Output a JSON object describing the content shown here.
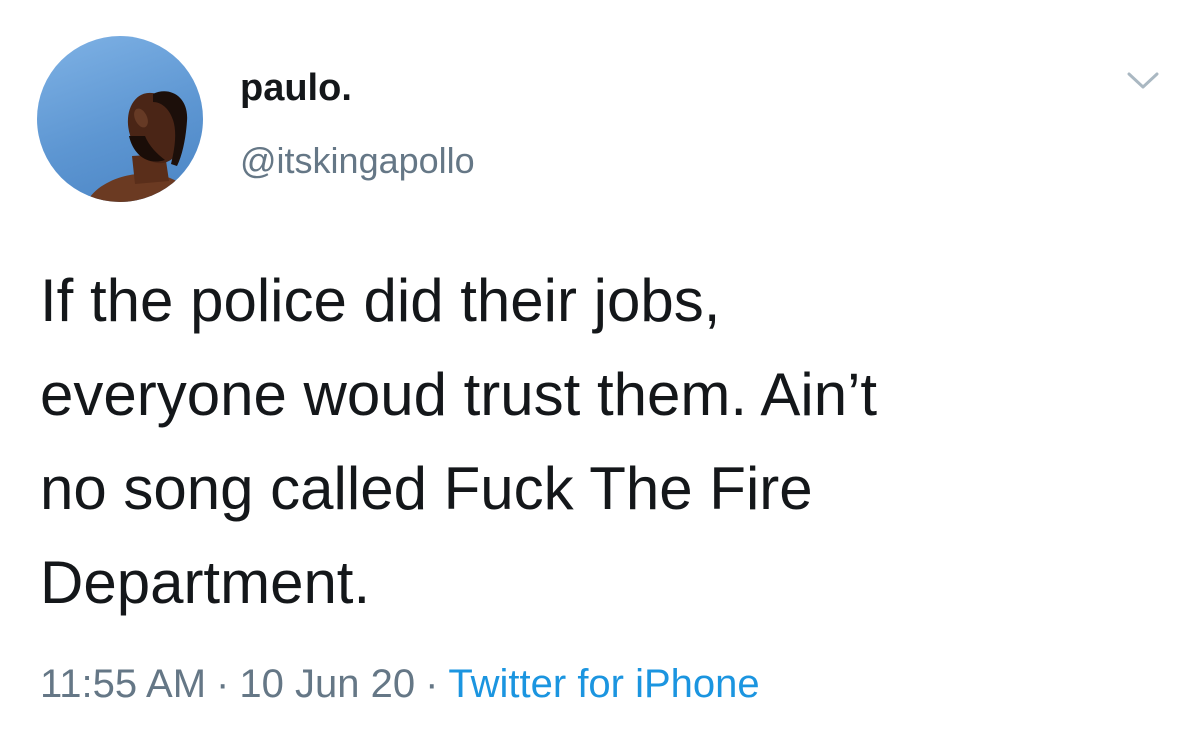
{
  "tweet": {
    "author": {
      "display_name": "paulo.",
      "handle": "@itskingapollo",
      "avatar_icon": "profile-photo"
    },
    "menu_icon": "chevron-down-icon",
    "text": "If the police did their jobs,\neveryone woud trust them. Ain’t\nno song called Fuck The Fire\nDepartment.",
    "time": "11:55 AM",
    "separator": "·",
    "date": "10 Jun 20",
    "source": "Twitter for iPhone",
    "colors": {
      "text": "#14171a",
      "secondary": "#657786",
      "link": "#1b95e0"
    }
  }
}
